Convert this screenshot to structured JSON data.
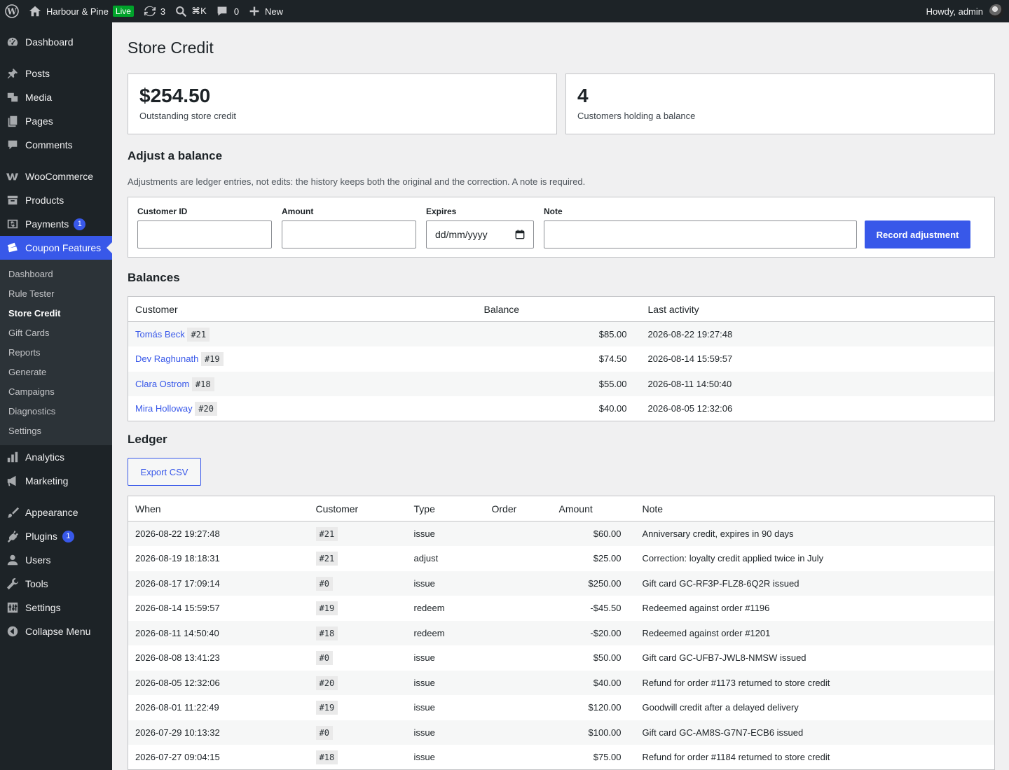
{
  "adminbar": {
    "site_name": "Harbour & Pine",
    "live_badge": "Live",
    "updates_count": "3",
    "search_hint": "⌘K",
    "comments_count": "0",
    "new_label": "New",
    "greeting": "Howdy, admin"
  },
  "sidebar": {
    "items": [
      {
        "label": "Dashboard",
        "icon": "dashboard-icon"
      },
      {
        "label": "Posts",
        "icon": "pin-icon"
      },
      {
        "label": "Media",
        "icon": "media-icon"
      },
      {
        "label": "Pages",
        "icon": "pages-icon"
      },
      {
        "label": "Comments",
        "icon": "comment-icon"
      },
      {
        "label": "WooCommerce",
        "icon": "woo-icon"
      },
      {
        "label": "Products",
        "icon": "archive-icon"
      },
      {
        "label": "Payments",
        "icon": "dollar-icon",
        "badge": "1"
      },
      {
        "label": "Coupon Features",
        "icon": "tickets-icon"
      },
      {
        "label": "Analytics",
        "icon": "bar-chart-icon"
      },
      {
        "label": "Marketing",
        "icon": "megaphone-icon"
      },
      {
        "label": "Appearance",
        "icon": "brush-icon"
      },
      {
        "label": "Plugins",
        "icon": "plug-icon",
        "badge": "1"
      },
      {
        "label": "Users",
        "icon": "user-icon"
      },
      {
        "label": "Tools",
        "icon": "wrench-icon"
      },
      {
        "label": "Settings",
        "icon": "sliders-icon"
      },
      {
        "label": "Collapse Menu",
        "icon": "collapse-icon"
      }
    ],
    "submenu": [
      "Dashboard",
      "Rule Tester",
      "Store Credit",
      "Gift Cards",
      "Reports",
      "Generate",
      "Campaigns",
      "Diagnostics",
      "Settings"
    ]
  },
  "page": {
    "title": "Store Credit",
    "cards": [
      {
        "value": "$254.50",
        "label": "Outstanding store credit"
      },
      {
        "value": "4",
        "label": "Customers holding a balance"
      }
    ],
    "adjust": {
      "heading": "Adjust a balance",
      "description": "Adjustments are ledger entries, not edits: the history keeps both the original and the correction. A note is required.",
      "customer_id_label": "Customer ID",
      "amount_label": "Amount",
      "expires_label": "Expires",
      "expires_placeholder": "dd/mm/yyyy",
      "note_label": "Note",
      "submit_label": "Record adjustment"
    },
    "balances": {
      "heading": "Balances",
      "columns": [
        "Customer",
        "Balance",
        "Last activity"
      ],
      "rows": [
        {
          "name": "Tomás Beck",
          "id": "#21",
          "balance": "$85.00",
          "last": "2026-08-22 19:27:48"
        },
        {
          "name": "Dev Raghunath",
          "id": "#19",
          "balance": "$74.50",
          "last": "2026-08-14 15:59:57"
        },
        {
          "name": "Clara Ostrom",
          "id": "#18",
          "balance": "$55.00",
          "last": "2026-08-11 14:50:40"
        },
        {
          "name": "Mira Holloway",
          "id": "#20",
          "balance": "$40.00",
          "last": "2026-08-05 12:32:06"
        }
      ]
    },
    "ledger": {
      "heading": "Ledger",
      "export_label": "Export CSV",
      "columns": [
        "When",
        "Customer",
        "Type",
        "Order",
        "Amount",
        "Note"
      ],
      "rows": [
        {
          "when": "2026-08-22 19:27:48",
          "customer": "#21",
          "type": "issue",
          "order": "",
          "amount": "$60.00",
          "note": "Anniversary credit, expires in 90 days"
        },
        {
          "when": "2026-08-19 18:18:31",
          "customer": "#21",
          "type": "adjust",
          "order": "",
          "amount": "$25.00",
          "note": "Correction: loyalty credit applied twice in July"
        },
        {
          "when": "2026-08-17 17:09:14",
          "customer": "#0",
          "type": "issue",
          "order": "",
          "amount": "$250.00",
          "note": "Gift card GC-RF3P-FLZ8-6Q2R issued"
        },
        {
          "when": "2026-08-14 15:59:57",
          "customer": "#19",
          "type": "redeem",
          "order": "",
          "amount": "-$45.50",
          "note": "Redeemed against order #1196"
        },
        {
          "when": "2026-08-11 14:50:40",
          "customer": "#18",
          "type": "redeem",
          "order": "",
          "amount": "-$20.00",
          "note": "Redeemed against order #1201"
        },
        {
          "when": "2026-08-08 13:41:23",
          "customer": "#0",
          "type": "issue",
          "order": "",
          "amount": "$50.00",
          "note": "Gift card GC-UFB7-JWL8-NMSW issued"
        },
        {
          "when": "2026-08-05 12:32:06",
          "customer": "#20",
          "type": "issue",
          "order": "",
          "amount": "$40.00",
          "note": "Refund for order #1173 returned to store credit"
        },
        {
          "when": "2026-08-01 11:22:49",
          "customer": "#19",
          "type": "issue",
          "order": "",
          "amount": "$120.00",
          "note": "Goodwill credit after a delayed delivery"
        },
        {
          "when": "2026-07-29 10:13:32",
          "customer": "#0",
          "type": "issue",
          "order": "",
          "amount": "$100.00",
          "note": "Gift card GC-AM8S-G7N7-ECB6 issued"
        },
        {
          "when": "2026-07-27 09:04:15",
          "customer": "#18",
          "type": "issue",
          "order": "",
          "amount": "$75.00",
          "note": "Refund for order #1184 returned to store credit"
        }
      ]
    }
  },
  "colors": {
    "accent": "#3858e9",
    "admin_dark": "#1d2327",
    "background": "#f0f0f1"
  }
}
